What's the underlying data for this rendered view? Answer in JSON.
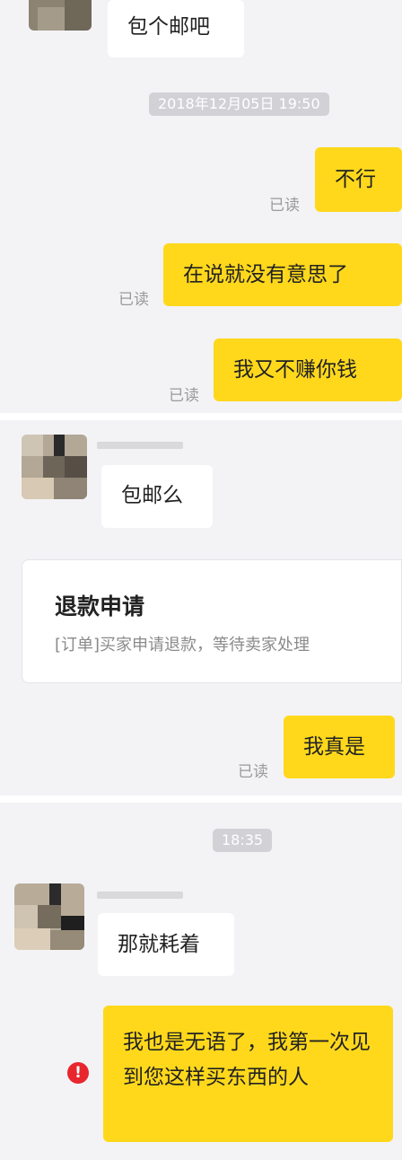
{
  "messages": {
    "m1": "包个邮吧",
    "m2": "不行",
    "m3": "在说就没有意思了",
    "m4": "我又不赚你钱",
    "m5": "包邮么",
    "m6": "我真是",
    "m7": "那就耗着",
    "m8": "我也是无语了，我第一次见到您这样买东西的人"
  },
  "timestamps": {
    "t1": "2018年12月05日 19:50",
    "t2": "18:35"
  },
  "read_label": "已读",
  "refund_card": {
    "title": "退款申请",
    "desc": "[订单]买家申请退款，等待卖家处理"
  },
  "error_icon_glyph": "!",
  "colors": {
    "accent_yellow": "#ffd81c",
    "error_red": "#e8262d"
  }
}
